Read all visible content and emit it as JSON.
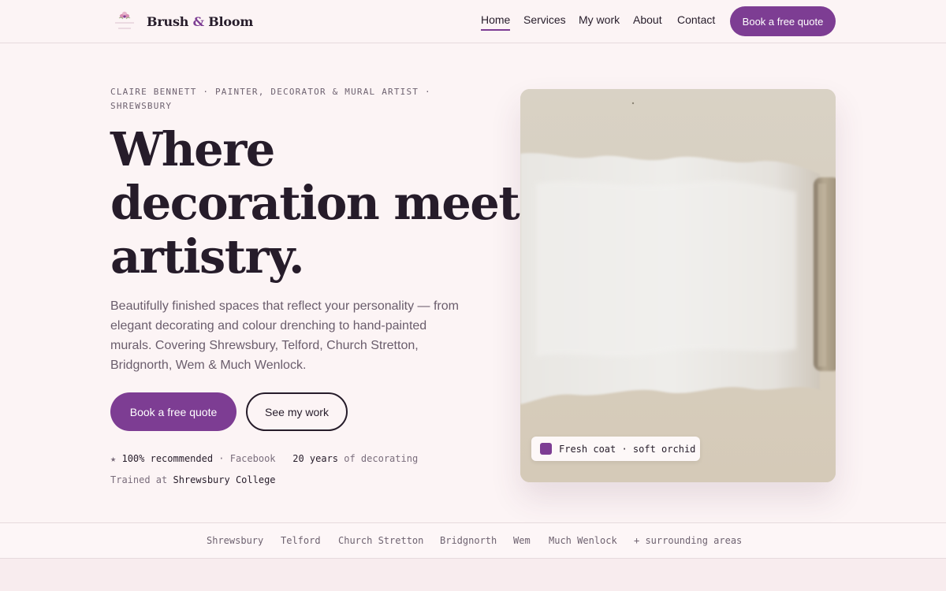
{
  "brand": {
    "name_part1": "Brush",
    "name_amp": "&",
    "name_part2": "Bloom",
    "logo_icon": "flower-logo-icon",
    "accent_color": "#7d3d93"
  },
  "nav": {
    "items": [
      {
        "label": "Home",
        "active": true
      },
      {
        "label": "Services",
        "active": false
      },
      {
        "label": "My work",
        "active": false
      },
      {
        "label": "About",
        "active": false
      },
      {
        "label": "Contact",
        "active": false
      }
    ],
    "cta_label": "Book a free quote"
  },
  "hero": {
    "eyebrow": "CLAIRE BENNETT · PAINTER, DECORATOR & MURAL ARTIST · SHREWSBURY",
    "headline_line1": "Where",
    "headline_line2": "decoration meets",
    "headline_line3": "artistry.",
    "lede": "Beautifully finished spaces that reflect your personality — from elegant decorating and colour drenching to hand-painted murals. Covering Shrewsbury, Telford, Church Stretton, Bridgnorth, Wem & Much Wenlock.",
    "primary_button": "Book a free quote",
    "secondary_button": "See my work",
    "meta_star": "★",
    "meta_recommended": "100% recommended",
    "meta_sep1": " · Facebook",
    "meta_years": "20 years",
    "meta_years_suffix": " of decorating",
    "meta_trained_prefix": "Trained at ",
    "meta_trained_place": "Shrewsbury College",
    "image_caption": "Fresh coat · soft orchid",
    "image_icon": "paint-roller-photo"
  },
  "areas": {
    "items": [
      "Shrewsbury",
      "Telford",
      "Church Stretton",
      "Bridgnorth",
      "Wem",
      "Much Wenlock",
      "+ surrounding areas"
    ]
  }
}
